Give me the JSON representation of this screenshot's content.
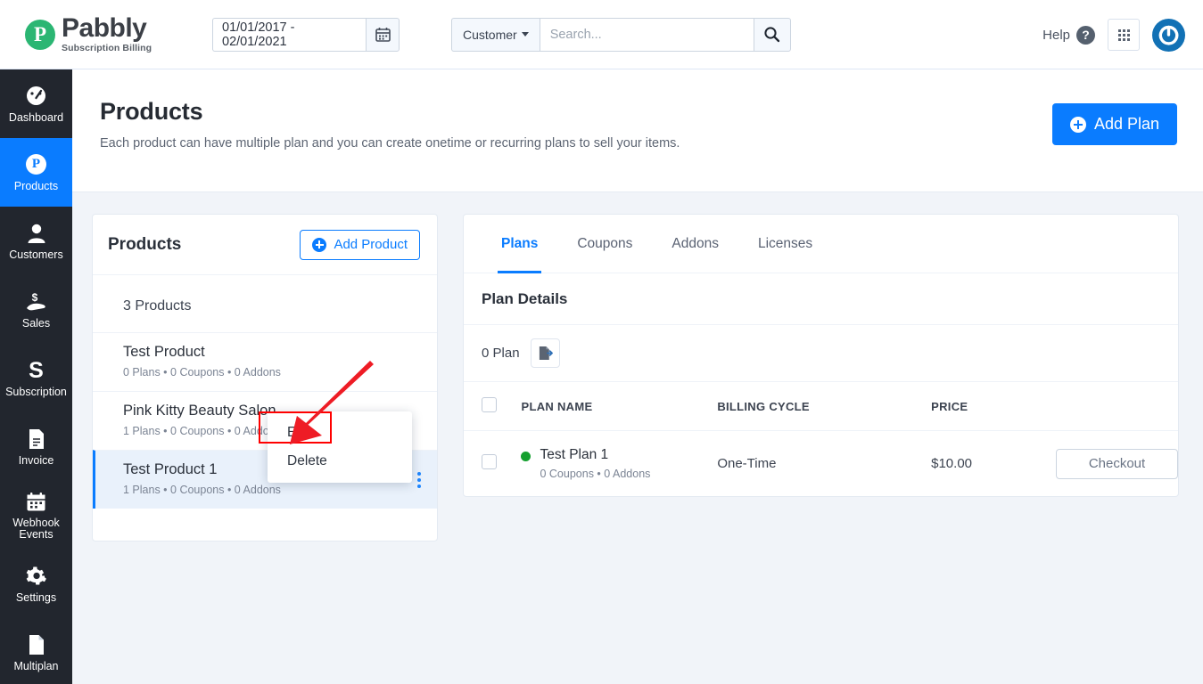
{
  "brand": {
    "logo_letter": "P",
    "name": "Pabbly",
    "tagline": "Subscription Billing",
    "accent_green": "#2bb673",
    "accent_blue": "#0a7cff"
  },
  "header": {
    "date_range": "01/01/2017 - 02/01/2021",
    "calendar_icon": "calendar-icon",
    "search_scope": "Customer",
    "search_placeholder": "Search...",
    "search_value": "",
    "search_icon": "search-icon",
    "help_label": "Help",
    "help_icon": "question-circle-icon",
    "apps_icon": "grid-apps-icon",
    "avatar_icon": "power-user-icon"
  },
  "sidebar": {
    "items": [
      {
        "label": "Dashboard",
        "icon": "gauge-icon",
        "active": false
      },
      {
        "label": "Products",
        "icon": "p-circle-icon",
        "active": true
      },
      {
        "label": "Customers",
        "icon": "person-icon",
        "active": false
      },
      {
        "label": "Sales",
        "icon": "hand-dollar-icon",
        "active": false
      },
      {
        "label": "Subscription",
        "icon": "s-letter-icon",
        "active": false
      },
      {
        "label": "Invoice",
        "icon": "document-icon",
        "active": false
      },
      {
        "label": "Webhook Events",
        "icon": "calendar-icon",
        "active": false
      },
      {
        "label": "Settings",
        "icon": "gear-icon",
        "active": false
      },
      {
        "label": "Multiplan",
        "icon": "page-icon",
        "active": false
      }
    ]
  },
  "page": {
    "title": "Products",
    "subtitle": "Each product can have multiple plan and you can create onetime or recurring plans to sell your items.",
    "add_plan_label": "Add Plan"
  },
  "products_panel": {
    "title": "Products",
    "add_product_label": "Add Product",
    "count_label": "3 Products",
    "items": [
      {
        "name": "Test Product",
        "meta": "0 Plans  • 0 Coupons  • 0 Addons",
        "selected": false
      },
      {
        "name": "Pink Kitty Beauty Salon",
        "meta": "1 Plans  • 0 Coupons  • 0 Addons",
        "selected": false
      },
      {
        "name": "Test Product 1",
        "meta": "1 Plans  • 0 Coupons  • 0 Addons",
        "selected": true
      }
    ]
  },
  "context_menu": {
    "visible": true,
    "highlighted": "Edit",
    "highlight_color": "#ff0000",
    "items": [
      {
        "label": "Edit"
      },
      {
        "label": "Delete"
      }
    ]
  },
  "plans_panel": {
    "tabs": [
      {
        "label": "Plans",
        "active": true
      },
      {
        "label": "Coupons",
        "active": false
      },
      {
        "label": "Addons",
        "active": false
      },
      {
        "label": "Licenses",
        "active": false
      }
    ],
    "section_title": "Plan Details",
    "plan_count_label": "0 Plan",
    "export_icon": "file-export-icon",
    "columns": [
      "",
      "PLAN NAME",
      "BILLING CYCLE",
      "PRICE",
      ""
    ],
    "rows": [
      {
        "checked": false,
        "status_color": "#15a02f",
        "name": "Test Plan 1",
        "meta": "0 Coupons  • 0 Addons",
        "billing_cycle": "One-Time",
        "price": "$10.00",
        "action_label": "Checkout"
      }
    ]
  },
  "annotation": {
    "arrow_color": "#ee1c25",
    "points_to": "Edit"
  }
}
